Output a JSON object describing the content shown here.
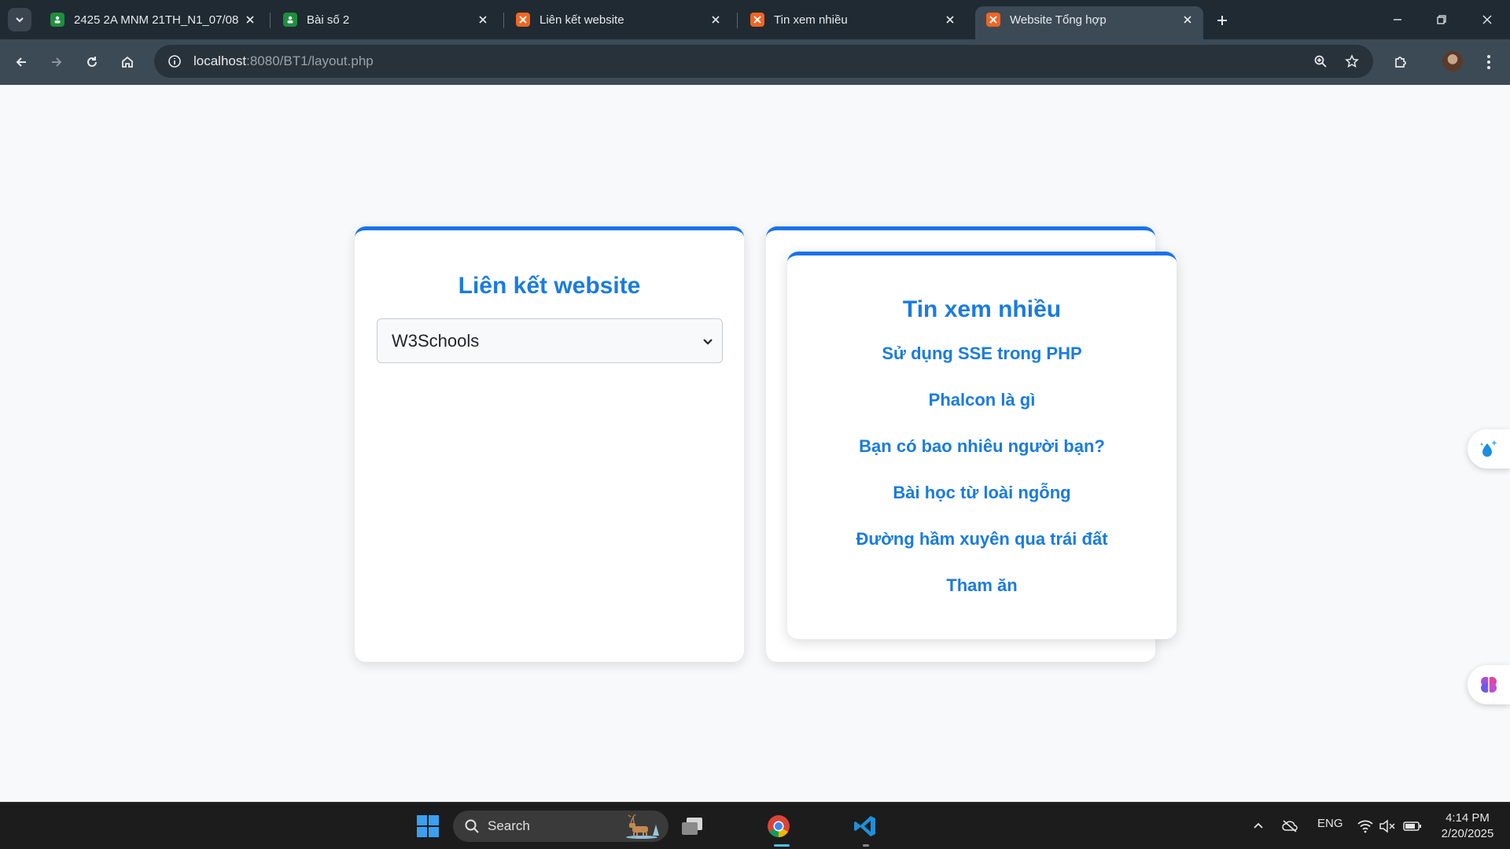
{
  "browser": {
    "tabs": [
      {
        "title": "2425 2A MNM 21TH_N1_07/08",
        "icon": "classroom-icon",
        "active": false
      },
      {
        "title": "Bài số 2",
        "icon": "classroom-icon",
        "active": false
      },
      {
        "title": "Liên kết website",
        "icon": "xampp-icon",
        "active": false
      },
      {
        "title": "Tin xem nhiều",
        "icon": "xampp-icon",
        "active": false
      },
      {
        "title": "Website Tổng hợp",
        "icon": "xampp-icon",
        "active": true
      }
    ],
    "url_host": "localhost",
    "url_rest": ":8080/BT1/layout.php"
  },
  "page": {
    "links_card": {
      "title": "Liên kết website",
      "selected_option": "W3Schools"
    },
    "news_card": {
      "title": "Tin xem nhiều",
      "items": [
        "Sử dụng SSE trong PHP",
        "Phalcon là gì",
        "Bạn có bao nhiêu người bạn?",
        "Bài học từ loài ngỗng",
        "Đường hầm xuyên qua trái đất",
        "Tham ăn"
      ]
    }
  },
  "taskbar": {
    "search_label": "Search",
    "language": "ENG",
    "time": "4:14 PM",
    "date": "2/20/2025"
  },
  "colors": {
    "accent": "#1a7be0",
    "chrome_dark": "#1f2a33",
    "chrome_toolbar": "#3c4a56"
  }
}
